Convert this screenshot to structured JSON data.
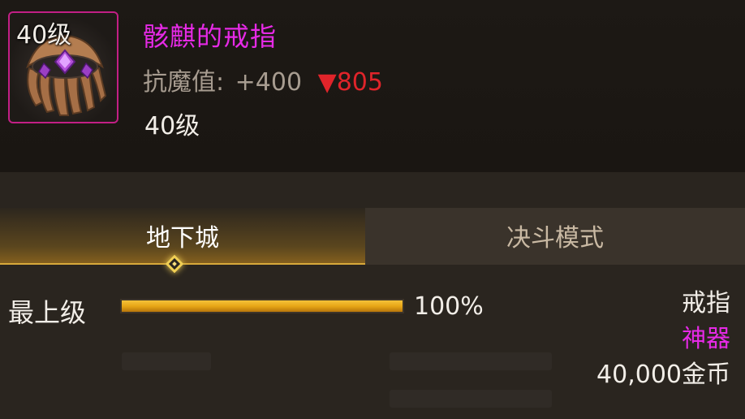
{
  "item": {
    "icon_name": "skeleton-ring-icon",
    "icon_level": "40级",
    "name": "骸麒的戒指",
    "stat_label": "抗魔值:",
    "stat_value": "+400",
    "stat_diff_arrow": "▼",
    "stat_diff_value": "805",
    "required_level": "40级"
  },
  "tabs": [
    {
      "label": "地下城",
      "active": true
    },
    {
      "label": "决斗模式",
      "active": false
    }
  ],
  "upgrade": {
    "level_label": "最上级",
    "progress": 1.0,
    "progress_text": "100%"
  },
  "info": {
    "type": "戒指",
    "rarity": "神器",
    "price": "40,000金币"
  },
  "colors": {
    "rarity_purple": "#e62ae6",
    "frame_border": "#c21f85",
    "decrease_red": "#e0242a",
    "progress_gold": "#e7a616"
  }
}
